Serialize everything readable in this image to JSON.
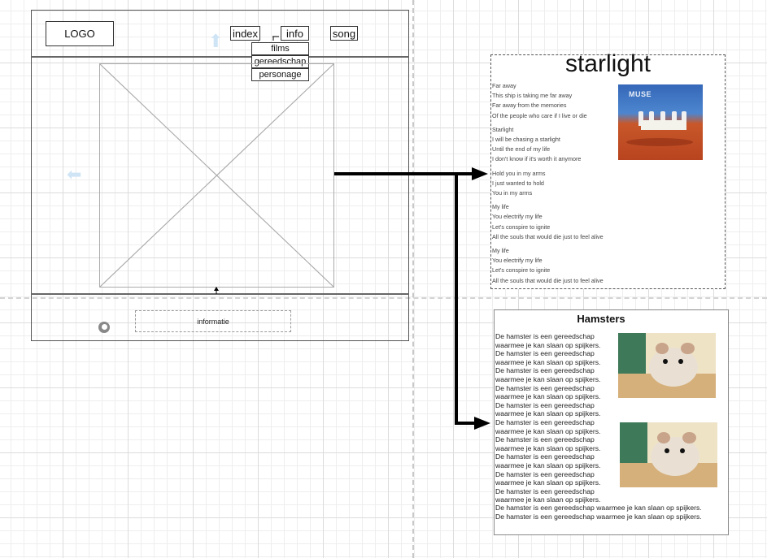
{
  "wireframe": {
    "logo_label": "LOGO",
    "nav": [
      "index",
      "info",
      "song"
    ],
    "dropdown": [
      "films",
      "gereedschap",
      "personage"
    ],
    "footer_label": "informatie"
  },
  "song_page": {
    "title": "starlight",
    "album_logo": "MUSE",
    "stanzas": [
      [
        "Far away",
        "This ship is taking me far away",
        "Far away from the memories",
        "Of the people who care if I live or die"
      ],
      [
        "Starlight",
        "I will be chasing a starlight",
        "Until the end of my life",
        "I don't know if it's worth it anymore"
      ],
      [
        "Hold you in my arms",
        "I just wanted to hold",
        "You in my arms"
      ],
      [
        "My life",
        "You electrify my life",
        "Let's conspire to ignite",
        "All the souls that would die just to feel alive"
      ],
      [
        "My life",
        "You electrify my life",
        "Let's conspire to ignite",
        "All the souls that would die just to feel alive"
      ]
    ]
  },
  "hamster_page": {
    "title": "Hamsters",
    "pair_line_1": "De hamster is een gereedschap",
    "pair_line_2": "waarmee je kan slaan op spijkers.",
    "pair_count": 10,
    "wide_line": "De hamster is een gereedschap waarmee je kan slaan op spijkers.",
    "wide_count": 2
  },
  "colors": {
    "connector": "#000000",
    "ghost_arrow": "#cfe5f6",
    "grid": "#dcdcdc"
  }
}
